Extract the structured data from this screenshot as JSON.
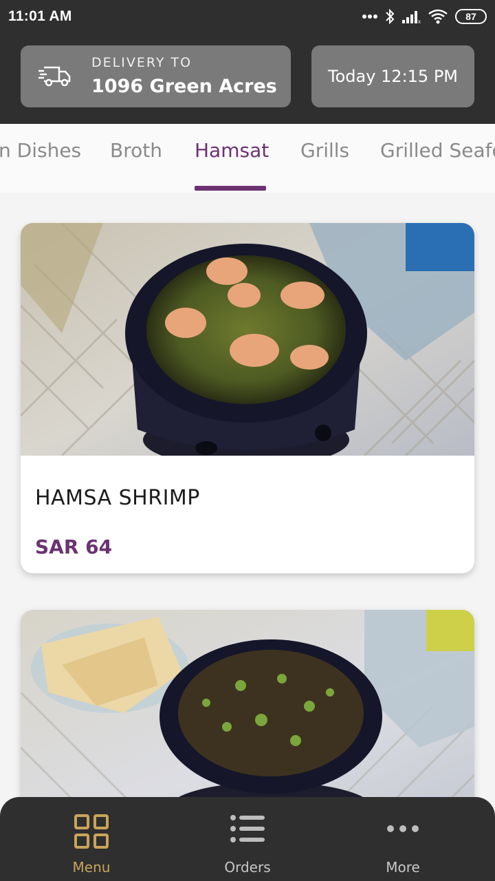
{
  "status_bar": {
    "time": "11:01 AM",
    "battery": "87"
  },
  "header": {
    "delivery_label": "DELIVERY TO",
    "delivery_address": "1096 Green Acres ...",
    "delivery_time": "Today 12:15 PM"
  },
  "tabs": [
    {
      "label": "n Dishes"
    },
    {
      "label": "Broth"
    },
    {
      "label": "Hamsat",
      "active": true
    },
    {
      "label": "Grills"
    },
    {
      "label": "Grilled Seafo"
    }
  ],
  "items": [
    {
      "name": "HAMSA SHRIMP",
      "price": "SAR 64"
    }
  ],
  "bottom_nav": [
    {
      "label": "Menu",
      "icon": "grid-icon",
      "active": true
    },
    {
      "label": "Orders",
      "icon": "list-icon"
    },
    {
      "label": "More",
      "icon": "more-dots-icon"
    }
  ],
  "colors": {
    "accent": "#6b3272",
    "nav_active": "#c9a45a",
    "bar_bg": "#2f2f2f"
  }
}
